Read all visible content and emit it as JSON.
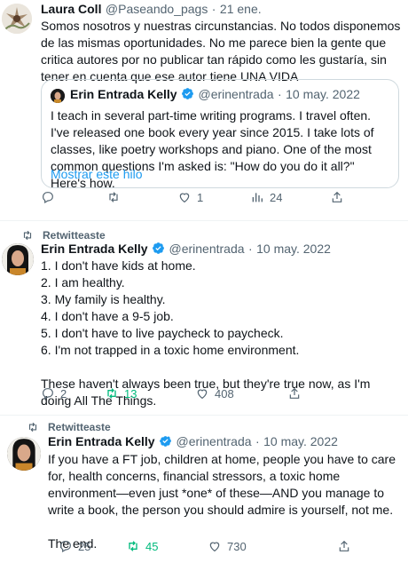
{
  "tweet1": {
    "name": "Laura Coll",
    "handle": "@Paseando_pags",
    "sep": "·",
    "date": "21 ene.",
    "text": "Somos nosotros y nuestras circunstancias. No todos disponemos de las mismas oportunidades. No me parece bien la gente que critica autores por no publicar tan rápido como les gustaría, sin tener en cuenta que ese autor tiene UNA VIDA",
    "quote": {
      "name": "Erin Entrada Kelly",
      "handle": "@erinentrada",
      "sep": "·",
      "date": "10 may. 2022",
      "text": "I teach in several part-time writing programs. I travel often. I've released one book every year since 2015. I take lots of classes, like poetry workshops and piano. One of the most common questions I'm asked is: \"How do you do it all?\" Here's how.",
      "show_thread": "Mostrar este hilo"
    },
    "replies": "",
    "retweets": "",
    "likes": "1",
    "views": "24"
  },
  "tweet2": {
    "retweet_label": "Retwitteaste",
    "name": "Erin Entrada Kelly",
    "handle": "@erinentrada",
    "sep": "·",
    "date": "10 may. 2022",
    "text": "1. I don't have kids at home.\n2. I am healthy.\n3. My family is healthy.\n4. I don't have a 9-5 job.\n5. I don't have to live paycheck to paycheck.\n6. I'm not trapped in a toxic home environment.\n\nThese haven't always been true, but they're true now, as I'm doing All The Things.",
    "replies": "2",
    "retweets": "13",
    "likes": "408"
  },
  "tweet3": {
    "retweet_label": "Retwitteaste",
    "name": "Erin Entrada Kelly",
    "handle": "@erinentrada",
    "sep": "·",
    "date": "10 may. 2022",
    "text": "If you have a FT job, children at home, people you have to care for, health concerns, financial stressors, a toxic home environment—even just *one* of these—AND you manage to write a book, the person you should admire is yourself, not me.\n\nThe end.",
    "replies": "25",
    "retweets": "45",
    "likes": "730"
  },
  "colors": {
    "link": "#1d9bf0",
    "retweet_active": "#00ba7c",
    "secondary": "#536471",
    "verified": "#1d9bf0"
  },
  "icons": [
    "reply-icon",
    "retweet-icon",
    "like-icon",
    "views-icon",
    "share-icon",
    "verified-badge-icon",
    "more-icon"
  ]
}
